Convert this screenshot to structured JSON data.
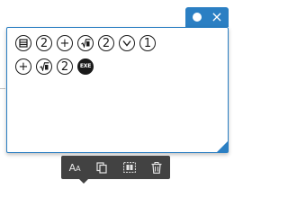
{
  "window": {
    "dot_icon": "circle-dot-icon",
    "close_glyph": "×",
    "accent_color": "#2b7fc3"
  },
  "note": {
    "row1": [
      {
        "icon": "list-menu-key-icon"
      },
      {
        "label": "2"
      },
      {
        "label": "+"
      },
      {
        "icon": "fraction-key-icon"
      },
      {
        "label": "2"
      },
      {
        "icon": "down-arrow-key-icon"
      },
      {
        "label": "1"
      }
    ],
    "row2": [
      {
        "label": "+"
      },
      {
        "icon": "fraction-key-icon"
      },
      {
        "label": "2"
      },
      {
        "label": "EXE"
      }
    ]
  },
  "toolbar": {
    "font_label": "A",
    "font_label_small": "A",
    "icons": [
      "font-size-icon",
      "copy-icon",
      "select-all-icon",
      "trash-icon"
    ],
    "background": "#424242"
  }
}
